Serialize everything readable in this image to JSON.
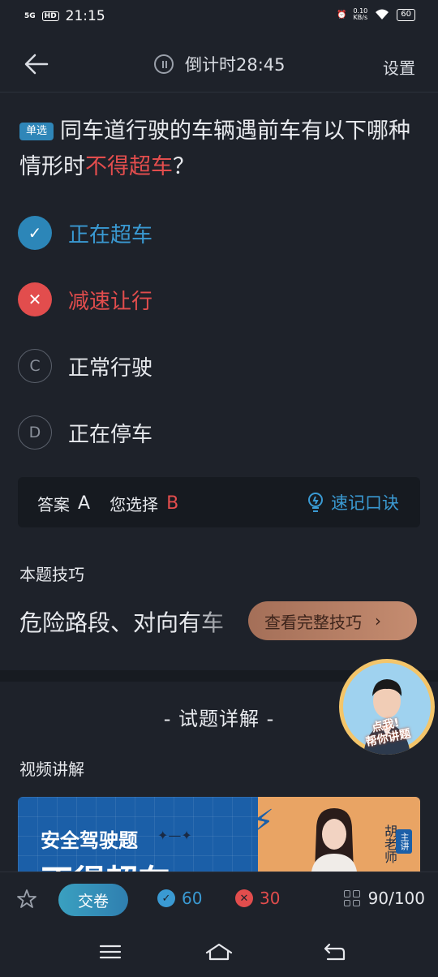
{
  "status_bar": {
    "signal": "5G",
    "hd": "HD",
    "time": "21:15",
    "net_speed": "0.10",
    "net_unit": "KB/s",
    "battery": "60"
  },
  "header": {
    "timer_label": "倒计时28:45",
    "settings_label": "设置"
  },
  "question": {
    "type_badge": "单选",
    "text_before": "同车道行驶的车辆遇前车有以下哪种情形时",
    "text_highlight": "不得超车",
    "text_after": "？"
  },
  "options": [
    {
      "marker": "✓",
      "label": "正在超车",
      "state": "correct"
    },
    {
      "marker": "✕",
      "label": "减速让行",
      "state": "wrong"
    },
    {
      "marker": "C",
      "label": "正常行驶",
      "state": "normal"
    },
    {
      "marker": "D",
      "label": "正在停车",
      "state": "normal"
    }
  ],
  "answer": {
    "answer_label": "答案",
    "answer_value": "A",
    "chosen_label": "您选择",
    "chosen_value": "B",
    "mnemonic_label": "速记口诀"
  },
  "tip": {
    "title": "本题技巧",
    "text": "危险路段、对向有车",
    "button_label": "查看完整技巧",
    "button_chevron": "›"
  },
  "explanation": {
    "title": "- 试题详解 -",
    "video_label": "视频讲解",
    "thumb_title": "安全驾驶题",
    "thumb_big": "不得超车",
    "thumb_teacher": "胡老师",
    "thumb_tag": "主讲"
  },
  "floating_helper": {
    "label_line1": "点我!",
    "label_line2": "帮你讲题"
  },
  "bottom_bar": {
    "submit_label": "交卷",
    "correct_count": "60",
    "wrong_count": "30",
    "progress": "90/100"
  },
  "colors": {
    "accent_blue": "#3a9ad3",
    "wrong_red": "#e24d4d",
    "background": "#1e222a"
  }
}
